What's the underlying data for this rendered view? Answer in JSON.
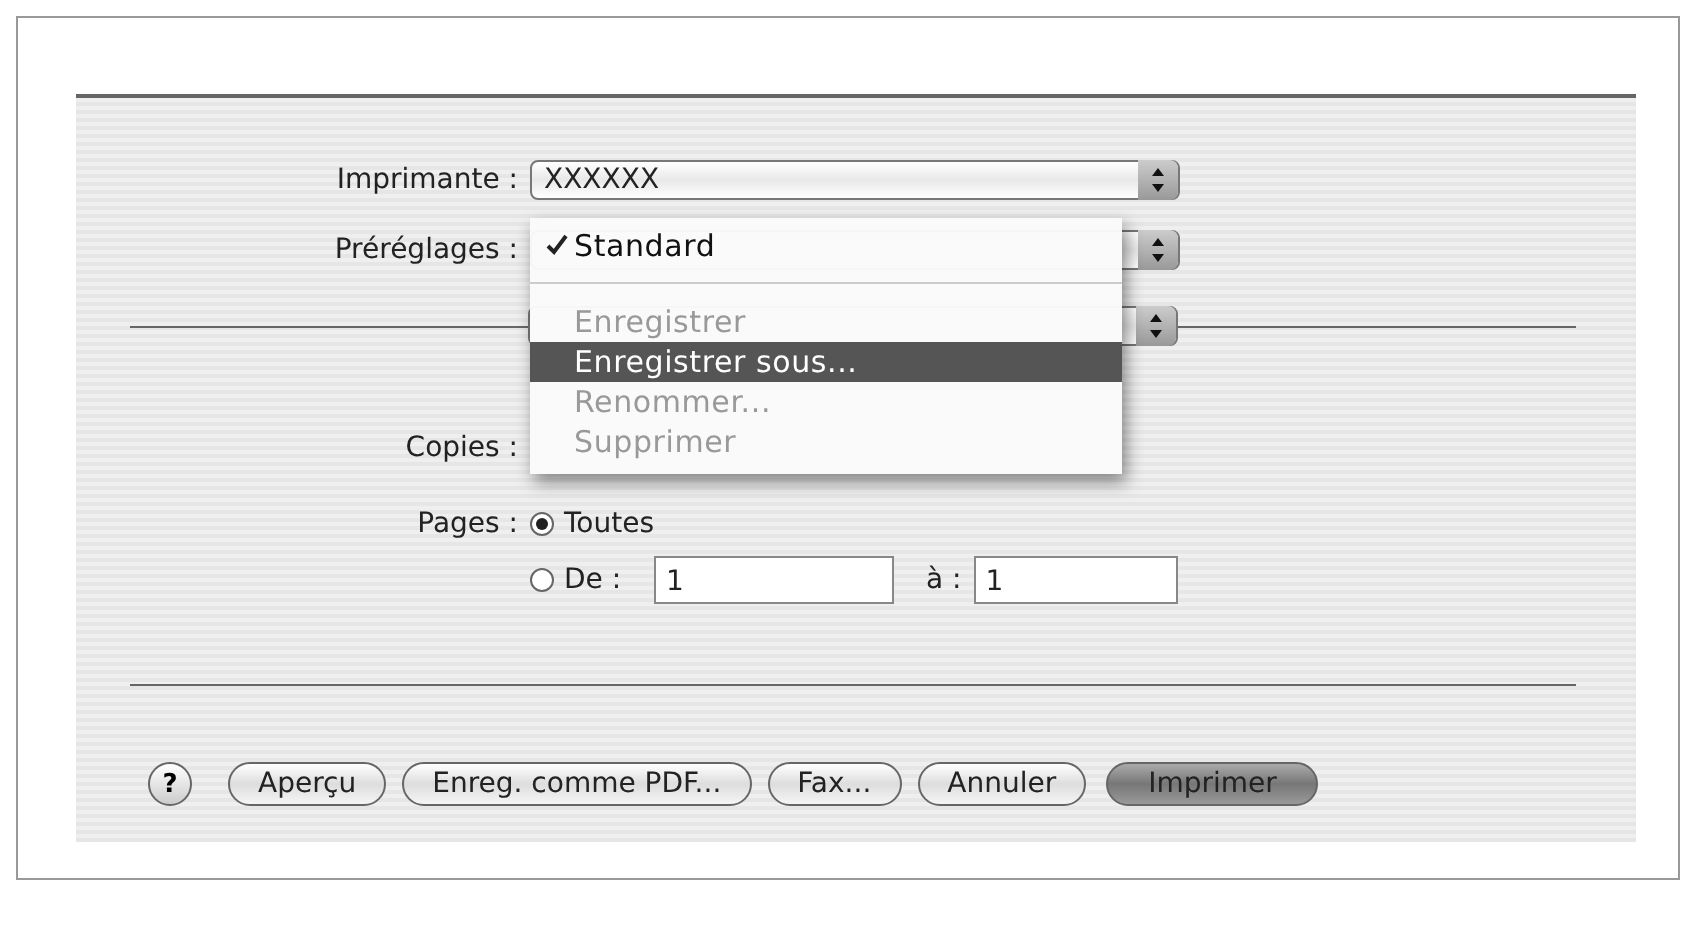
{
  "printer": {
    "label": "Imprimante :",
    "value": "XXXXXX"
  },
  "presets": {
    "label": "Préréglages :"
  },
  "presets_menu": {
    "items": [
      {
        "kind": "item",
        "label": "Standard",
        "checked": true,
        "disabled": false,
        "highlighted": false
      },
      {
        "kind": "separator"
      },
      {
        "kind": "item",
        "label": "Enregistrer",
        "checked": false,
        "disabled": true,
        "highlighted": false
      },
      {
        "kind": "item",
        "label": "Enregistrer sous...",
        "checked": false,
        "disabled": false,
        "highlighted": true
      },
      {
        "kind": "item",
        "label": "Renommer...",
        "checked": false,
        "disabled": true,
        "highlighted": false
      },
      {
        "kind": "item",
        "label": "Supprimer",
        "checked": false,
        "disabled": true,
        "highlighted": false
      }
    ]
  },
  "copies": {
    "label": "Copies :"
  },
  "pages": {
    "label": "Pages :",
    "options": [
      {
        "label": "Toutes",
        "selected": true
      },
      {
        "label": "De :",
        "selected": false
      }
    ],
    "from": "1",
    "to_label": "à :",
    "to": "1"
  },
  "buttons": [
    {
      "kind": "help",
      "label": "?"
    },
    {
      "kind": "normal",
      "label": "Aperçu"
    },
    {
      "kind": "normal",
      "label": "Enreg. comme PDF..."
    },
    {
      "kind": "normal",
      "label": "Fax..."
    },
    {
      "kind": "normal",
      "label": "Annuler"
    },
    {
      "kind": "default",
      "label": "Imprimer"
    }
  ]
}
